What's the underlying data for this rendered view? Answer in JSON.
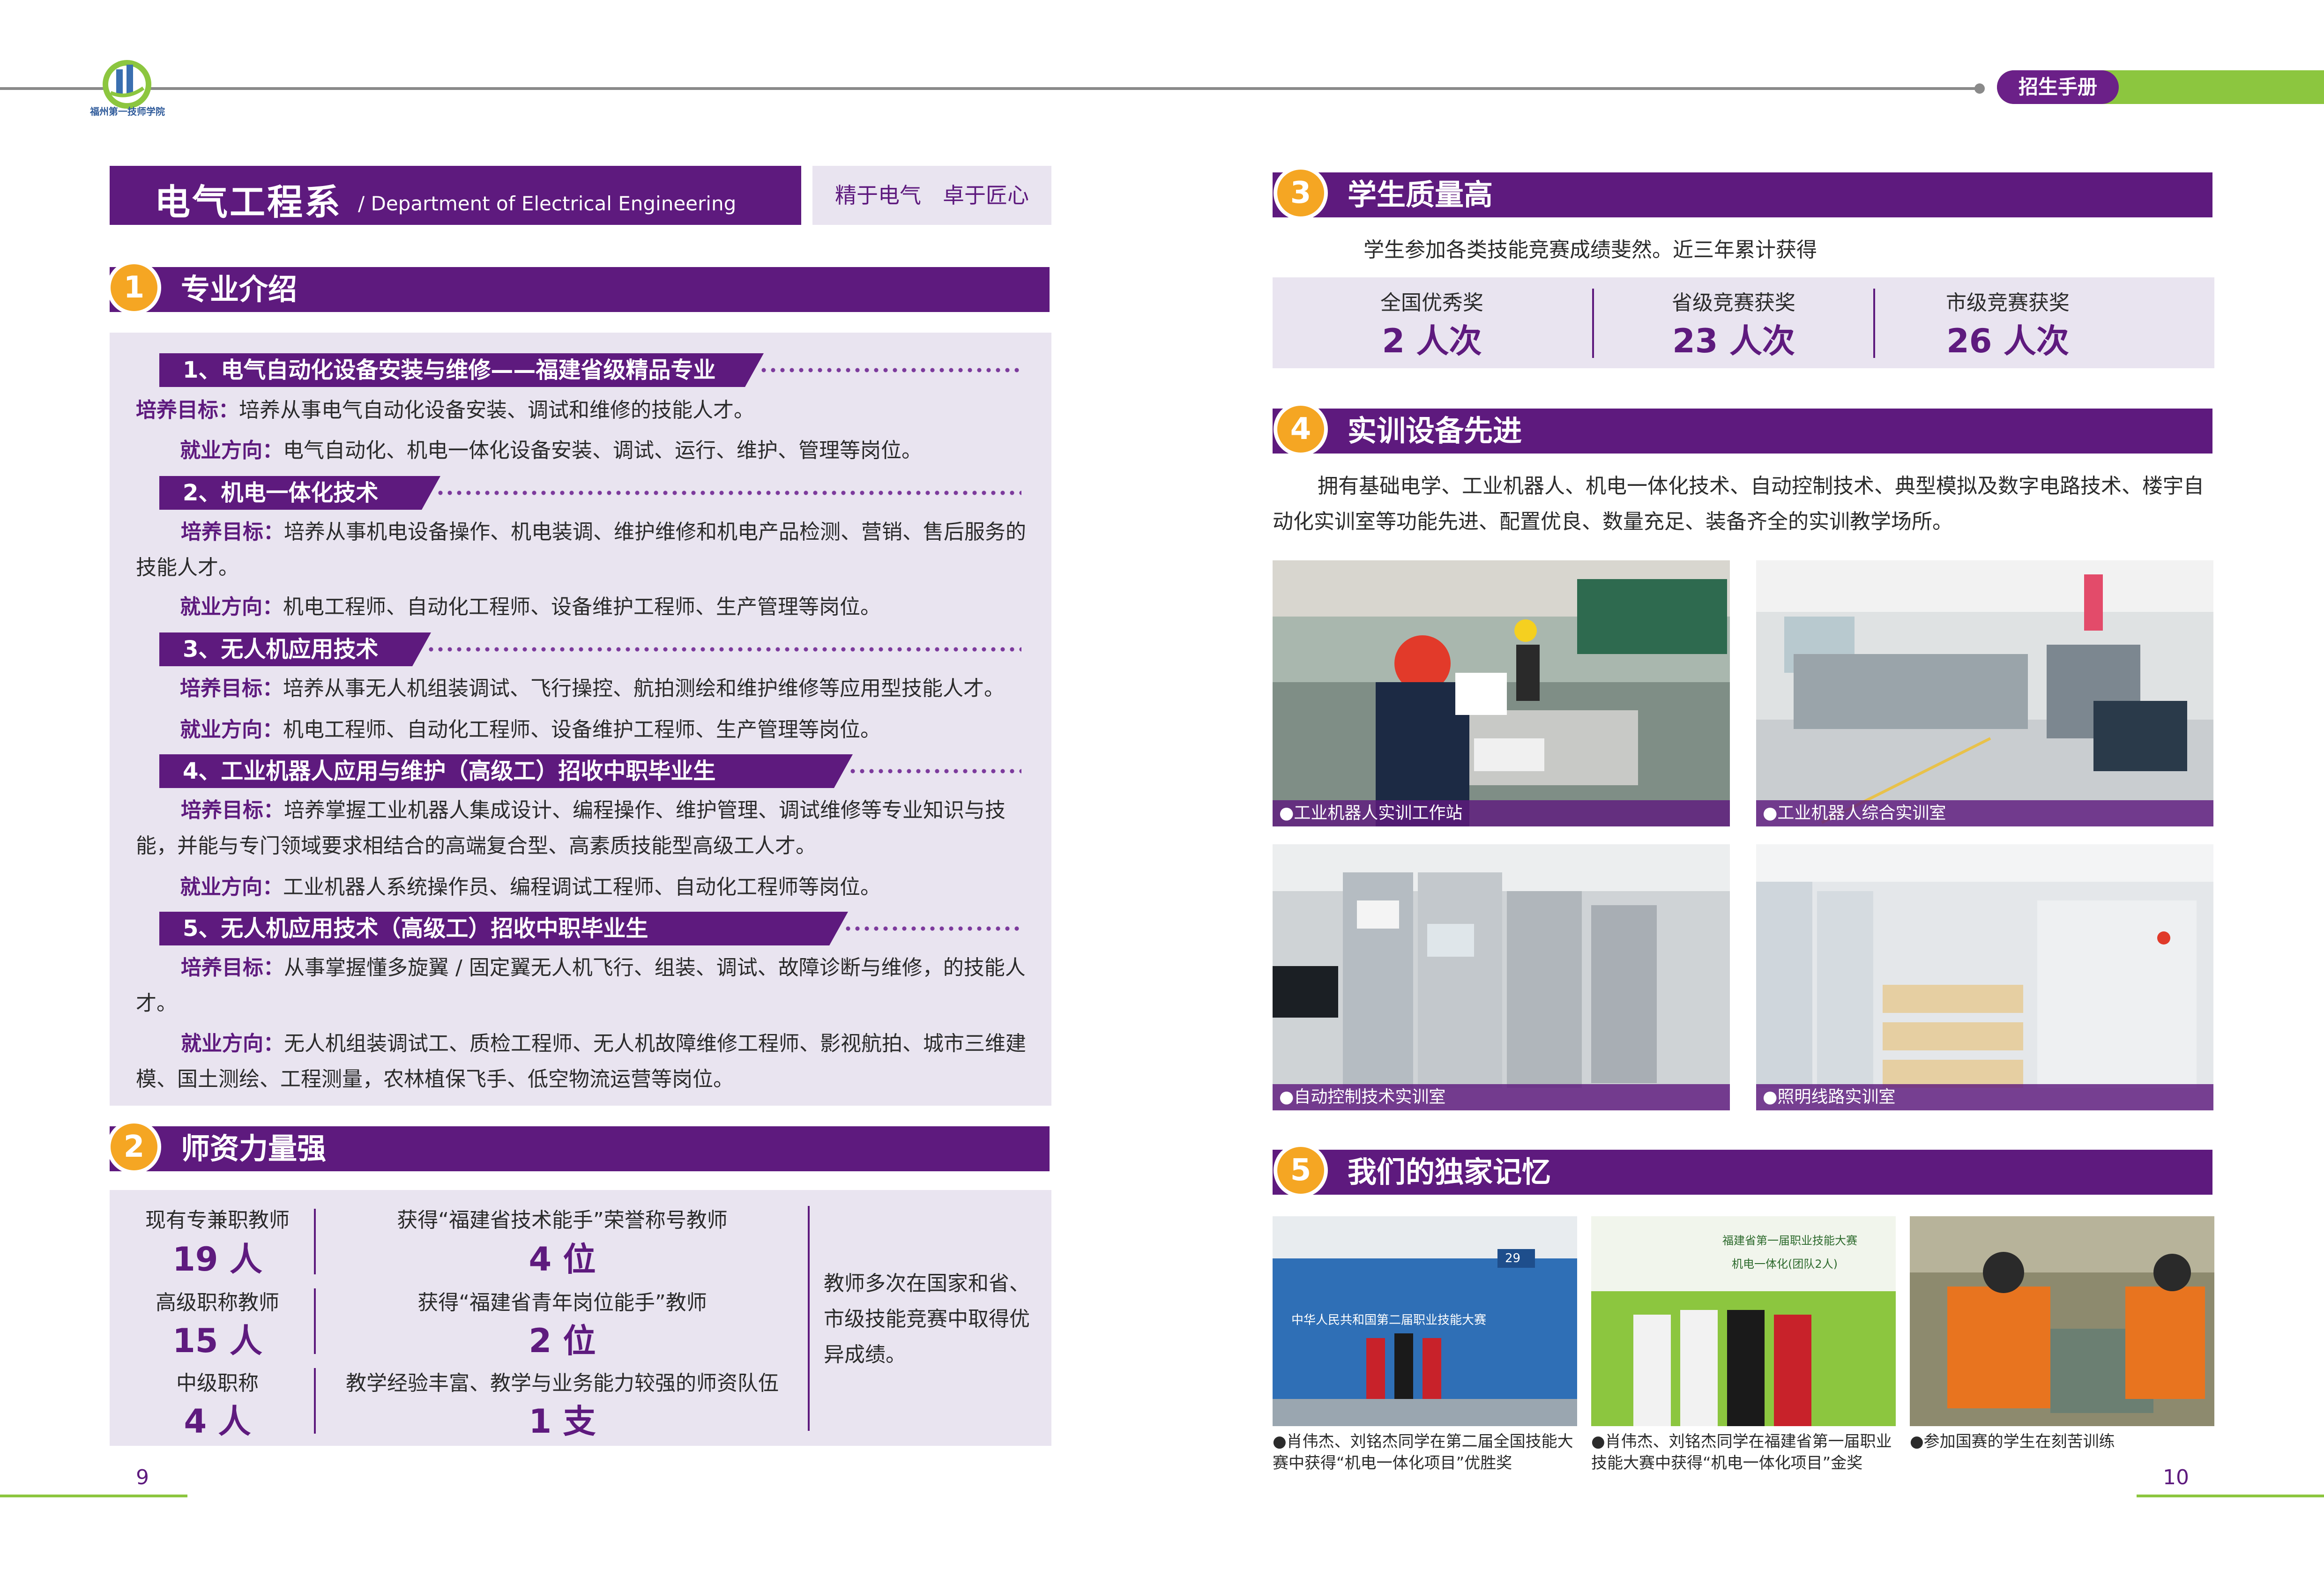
{
  "header": {
    "logo_text": "福州第一技师学院",
    "brochure_label": "招生手册"
  },
  "dept": {
    "title_cn": "电气工程系",
    "title_en": "/ Department of Electrical Engineering",
    "motto": "精于电气　卓于匠心"
  },
  "sections": {
    "s1": {
      "num": "1",
      "title": "专业介绍"
    },
    "s2": {
      "num": "2",
      "title": "师资力量强"
    },
    "s3": {
      "num": "3",
      "title": "学生质量高"
    },
    "s4": {
      "num": "4",
      "title": "实训设备先进"
    },
    "s5": {
      "num": "5",
      "title": "我们的独家记忆"
    }
  },
  "majors": [
    {
      "title": "1、电气自动化设备安装与维修——福建省级精品专业",
      "goal_label": "培养目标：",
      "goal": "培养从事电气自动化设备安装、调试和维修的技能人才。",
      "dir_label": "就业方向：",
      "dir": "电气自动化、机电一体化设备安装、调试、运行、维护、管理等岗位。"
    },
    {
      "title": "2、机电一体化技术",
      "goal_label": "培养目标：",
      "goal": "培养从事机电设备操作、机电装调、维护维修和机电产品检测、营销、售后服务的技能人才。",
      "dir_label": "就业方向：",
      "dir": "机电工程师、自动化工程师、设备维护工程师、生产管理等岗位。"
    },
    {
      "title": "3、无人机应用技术",
      "goal_label": "培养目标：",
      "goal": "培养从事无人机组装调试、飞行操控、航拍测绘和维护维修等应用型技能人才。",
      "dir_label": "就业方向：",
      "dir": "机电工程师、自动化工程师、设备维护工程师、生产管理等岗位。"
    },
    {
      "title": "4、工业机器人应用与维护（高级工）招收中职毕业生",
      "goal_label": "培养目标：",
      "goal": "培养掌握工业机器人集成设计、编程操作、维护管理、调试维修等专业知识与技能，并能与专门领域要求相结合的高端复合型、高素质技能型高级工人才。",
      "dir_label": "就业方向：",
      "dir": "工业机器人系统操作员、编程调试工程师、自动化工程师等岗位。"
    },
    {
      "title": "5、无人机应用技术（高级工）招收中职毕业生",
      "goal_label": "培养目标：",
      "goal": "从事掌握懂多旋翼 / 固定翼无人机飞行、组装、调试、故障诊断与维修，的技能人才。",
      "dir_label": "就业方向：",
      "dir": "无人机组装调试工、质检工程师、无人机故障维修工程师、影视航拍、城市三维建模、国土测绘、工程测量，农林植保飞手、低空物流运营等岗位。"
    }
  ],
  "teachers": {
    "left": [
      {
        "label": "现有专兼职教师",
        "value": "19 人"
      },
      {
        "label": "高级职称教师",
        "value": "15 人"
      },
      {
        "label": "中级职称",
        "value": "4 人"
      }
    ],
    "mid": [
      {
        "label": "获得“福建省技术能手”荣誉称号教师",
        "value": "4 位"
      },
      {
        "label": "获得“福建省青年岗位能手”教师",
        "value": "2 位"
      },
      {
        "label": "教学经验丰富、教学与业务能力较强的师资队伍",
        "value": "1 支"
      }
    ],
    "note": "教师多次在国家和省、市级技能竞赛中取得优异成绩。"
  },
  "students": {
    "intro": "学生参加各类技能竞赛成绩斐然。近三年累计获得",
    "awards": [
      {
        "label": "全国优秀奖",
        "value": "2 人次"
      },
      {
        "label": "省级竞赛获奖",
        "value": "23 人次"
      },
      {
        "label": "市级竞赛获奖",
        "value": "26 人次"
      }
    ]
  },
  "equipment": {
    "intro": "拥有基础电学、工业机器人、机电一体化技术、自动控制技术、典型模拟及数字电路技术、楼宇自动化实训室等功能先进、配置优良、数量充足、装备齐全的实训教学场所。",
    "photos": [
      {
        "caption": "●工业机器人实训工作站"
      },
      {
        "caption": "●工业机器人综合实训室"
      },
      {
        "caption": "●自动控制技术实训室"
      },
      {
        "caption": "●照明线路实训室"
      }
    ]
  },
  "memories": [
    {
      "caption": "●肖伟杰、刘铭杰同学在第二届全国技能大赛中获得“机电一体化项目”优胜奖",
      "sign_text": "中华人民共和国第二届职业技能大赛",
      "board_text": "29"
    },
    {
      "caption": "●肖伟杰、刘铭杰同学在福建省第一届职业技能大赛中获得“机电一体化项目”金奖",
      "sign_text": "福建省第一届职业技能大赛",
      "board_text": "机电一体化(团队2人)"
    },
    {
      "caption": "●参加国赛的学生在刻苦训练"
    }
  ],
  "footer": {
    "left_page": "9",
    "right_page": "10"
  },
  "colors": {
    "purple": "#5e1a7e",
    "orange": "#f5a623",
    "green": "#8cc63f",
    "panel": "#e9e4f0"
  }
}
